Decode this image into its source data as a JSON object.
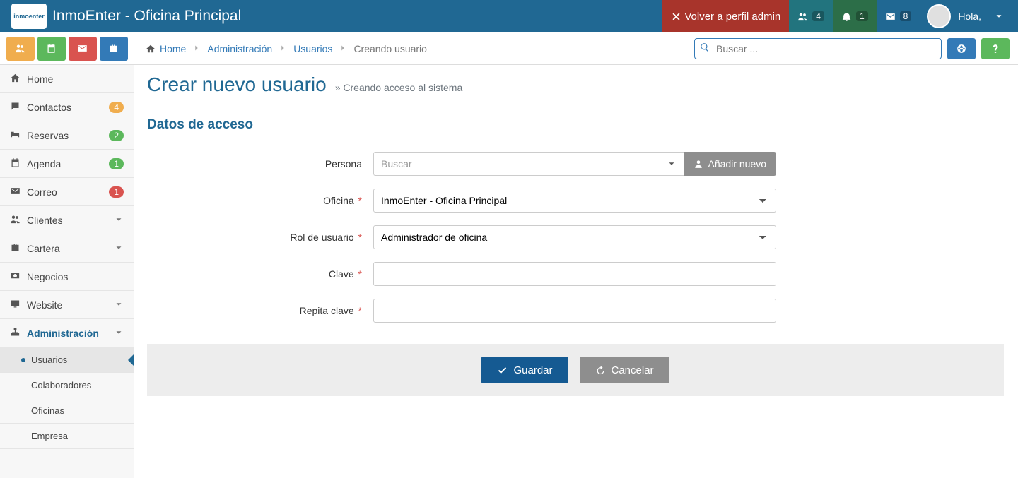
{
  "header": {
    "app_title": "InmoEnter - Oficina Principal",
    "back_admin": "Volver a perfil admin",
    "badge_users": "4",
    "badge_bell": "1",
    "badge_mail": "8",
    "user_greet": "Hola,"
  },
  "breadcrumb": {
    "home": "Home",
    "admin": "Administración",
    "users": "Usuarios",
    "current": "Creando usuario"
  },
  "search": {
    "placeholder": "Buscar ..."
  },
  "sidebar": {
    "home": "Home",
    "contactos": "Contactos",
    "reservas": "Reservas",
    "agenda": "Agenda",
    "correo": "Correo",
    "clientes": "Clientes",
    "cartera": "Cartera",
    "negocios": "Negocios",
    "website": "Website",
    "admin": "Administración",
    "badges": {
      "contactos": "4",
      "reservas": "2",
      "agenda": "1",
      "correo": "1"
    },
    "sub": {
      "usuarios": "Usuarios",
      "colaboradores": "Colaboradores",
      "oficinas": "Oficinas",
      "empresa": "Empresa"
    }
  },
  "page": {
    "title": "Crear nuevo usuario",
    "subtitle": "Creando acceso al sistema",
    "section": "Datos de acceso"
  },
  "form": {
    "persona_label": "Persona",
    "persona_placeholder": "Buscar",
    "add_new": "Añadir nuevo",
    "oficina_label": "Oficina",
    "oficina_value": "InmoEnter - Oficina Principal",
    "rol_label": "Rol de usuario",
    "rol_value": "Administrador de oficina",
    "clave_label": "Clave",
    "repita_label": "Repita clave"
  },
  "actions": {
    "save": "Guardar",
    "cancel": "Cancelar"
  }
}
